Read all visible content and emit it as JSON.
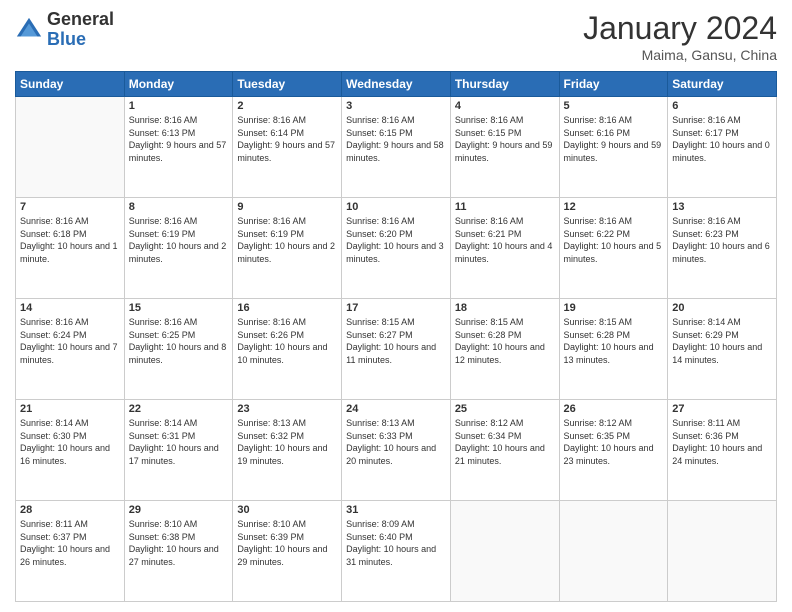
{
  "header": {
    "logo_general": "General",
    "logo_blue": "Blue",
    "title": "January 2024",
    "subtitle": "Maima, Gansu, China"
  },
  "days_of_week": [
    "Sunday",
    "Monday",
    "Tuesday",
    "Wednesday",
    "Thursday",
    "Friday",
    "Saturday"
  ],
  "weeks": [
    [
      {
        "day": "",
        "sunrise": "",
        "sunset": "",
        "daylight": ""
      },
      {
        "day": "1",
        "sunrise": "Sunrise: 8:16 AM",
        "sunset": "Sunset: 6:13 PM",
        "daylight": "Daylight: 9 hours and 57 minutes."
      },
      {
        "day": "2",
        "sunrise": "Sunrise: 8:16 AM",
        "sunset": "Sunset: 6:14 PM",
        "daylight": "Daylight: 9 hours and 57 minutes."
      },
      {
        "day": "3",
        "sunrise": "Sunrise: 8:16 AM",
        "sunset": "Sunset: 6:15 PM",
        "daylight": "Daylight: 9 hours and 58 minutes."
      },
      {
        "day": "4",
        "sunrise": "Sunrise: 8:16 AM",
        "sunset": "Sunset: 6:15 PM",
        "daylight": "Daylight: 9 hours and 59 minutes."
      },
      {
        "day": "5",
        "sunrise": "Sunrise: 8:16 AM",
        "sunset": "Sunset: 6:16 PM",
        "daylight": "Daylight: 9 hours and 59 minutes."
      },
      {
        "day": "6",
        "sunrise": "Sunrise: 8:16 AM",
        "sunset": "Sunset: 6:17 PM",
        "daylight": "Daylight: 10 hours and 0 minutes."
      }
    ],
    [
      {
        "day": "7",
        "sunrise": "Sunrise: 8:16 AM",
        "sunset": "Sunset: 6:18 PM",
        "daylight": "Daylight: 10 hours and 1 minute."
      },
      {
        "day": "8",
        "sunrise": "Sunrise: 8:16 AM",
        "sunset": "Sunset: 6:19 PM",
        "daylight": "Daylight: 10 hours and 2 minutes."
      },
      {
        "day": "9",
        "sunrise": "Sunrise: 8:16 AM",
        "sunset": "Sunset: 6:19 PM",
        "daylight": "Daylight: 10 hours and 2 minutes."
      },
      {
        "day": "10",
        "sunrise": "Sunrise: 8:16 AM",
        "sunset": "Sunset: 6:20 PM",
        "daylight": "Daylight: 10 hours and 3 minutes."
      },
      {
        "day": "11",
        "sunrise": "Sunrise: 8:16 AM",
        "sunset": "Sunset: 6:21 PM",
        "daylight": "Daylight: 10 hours and 4 minutes."
      },
      {
        "day": "12",
        "sunrise": "Sunrise: 8:16 AM",
        "sunset": "Sunset: 6:22 PM",
        "daylight": "Daylight: 10 hours and 5 minutes."
      },
      {
        "day": "13",
        "sunrise": "Sunrise: 8:16 AM",
        "sunset": "Sunset: 6:23 PM",
        "daylight": "Daylight: 10 hours and 6 minutes."
      }
    ],
    [
      {
        "day": "14",
        "sunrise": "Sunrise: 8:16 AM",
        "sunset": "Sunset: 6:24 PM",
        "daylight": "Daylight: 10 hours and 7 minutes."
      },
      {
        "day": "15",
        "sunrise": "Sunrise: 8:16 AM",
        "sunset": "Sunset: 6:25 PM",
        "daylight": "Daylight: 10 hours and 8 minutes."
      },
      {
        "day": "16",
        "sunrise": "Sunrise: 8:16 AM",
        "sunset": "Sunset: 6:26 PM",
        "daylight": "Daylight: 10 hours and 10 minutes."
      },
      {
        "day": "17",
        "sunrise": "Sunrise: 8:15 AM",
        "sunset": "Sunset: 6:27 PM",
        "daylight": "Daylight: 10 hours and 11 minutes."
      },
      {
        "day": "18",
        "sunrise": "Sunrise: 8:15 AM",
        "sunset": "Sunset: 6:28 PM",
        "daylight": "Daylight: 10 hours and 12 minutes."
      },
      {
        "day": "19",
        "sunrise": "Sunrise: 8:15 AM",
        "sunset": "Sunset: 6:28 PM",
        "daylight": "Daylight: 10 hours and 13 minutes."
      },
      {
        "day": "20",
        "sunrise": "Sunrise: 8:14 AM",
        "sunset": "Sunset: 6:29 PM",
        "daylight": "Daylight: 10 hours and 14 minutes."
      }
    ],
    [
      {
        "day": "21",
        "sunrise": "Sunrise: 8:14 AM",
        "sunset": "Sunset: 6:30 PM",
        "daylight": "Daylight: 10 hours and 16 minutes."
      },
      {
        "day": "22",
        "sunrise": "Sunrise: 8:14 AM",
        "sunset": "Sunset: 6:31 PM",
        "daylight": "Daylight: 10 hours and 17 minutes."
      },
      {
        "day": "23",
        "sunrise": "Sunrise: 8:13 AM",
        "sunset": "Sunset: 6:32 PM",
        "daylight": "Daylight: 10 hours and 19 minutes."
      },
      {
        "day": "24",
        "sunrise": "Sunrise: 8:13 AM",
        "sunset": "Sunset: 6:33 PM",
        "daylight": "Daylight: 10 hours and 20 minutes."
      },
      {
        "day": "25",
        "sunrise": "Sunrise: 8:12 AM",
        "sunset": "Sunset: 6:34 PM",
        "daylight": "Daylight: 10 hours and 21 minutes."
      },
      {
        "day": "26",
        "sunrise": "Sunrise: 8:12 AM",
        "sunset": "Sunset: 6:35 PM",
        "daylight": "Daylight: 10 hours and 23 minutes."
      },
      {
        "day": "27",
        "sunrise": "Sunrise: 8:11 AM",
        "sunset": "Sunset: 6:36 PM",
        "daylight": "Daylight: 10 hours and 24 minutes."
      }
    ],
    [
      {
        "day": "28",
        "sunrise": "Sunrise: 8:11 AM",
        "sunset": "Sunset: 6:37 PM",
        "daylight": "Daylight: 10 hours and 26 minutes."
      },
      {
        "day": "29",
        "sunrise": "Sunrise: 8:10 AM",
        "sunset": "Sunset: 6:38 PM",
        "daylight": "Daylight: 10 hours and 27 minutes."
      },
      {
        "day": "30",
        "sunrise": "Sunrise: 8:10 AM",
        "sunset": "Sunset: 6:39 PM",
        "daylight": "Daylight: 10 hours and 29 minutes."
      },
      {
        "day": "31",
        "sunrise": "Sunrise: 8:09 AM",
        "sunset": "Sunset: 6:40 PM",
        "daylight": "Daylight: 10 hours and 31 minutes."
      },
      {
        "day": "",
        "sunrise": "",
        "sunset": "",
        "daylight": ""
      },
      {
        "day": "",
        "sunrise": "",
        "sunset": "",
        "daylight": ""
      },
      {
        "day": "",
        "sunrise": "",
        "sunset": "",
        "daylight": ""
      }
    ]
  ]
}
